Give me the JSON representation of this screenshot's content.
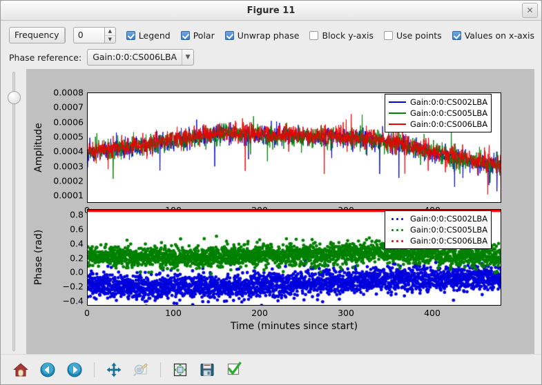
{
  "window": {
    "title": "Figure 11",
    "close_label": "✕"
  },
  "controls": {
    "axis_select": {
      "value": "Frequency",
      "arrow": "chevron-down-icon"
    },
    "index_spinner": {
      "value": "0",
      "up": "▲",
      "down": "▼"
    },
    "checkboxes": [
      {
        "label": "Legend",
        "checked": true
      },
      {
        "label": "Polar",
        "checked": true
      },
      {
        "label": "Unwrap phase",
        "checked": true
      },
      {
        "label": "Block y-axis",
        "checked": false
      },
      {
        "label": "Use points",
        "checked": false
      },
      {
        "label": "Values on x-axis",
        "checked": true
      }
    ],
    "phase_reference": {
      "label": "Phase reference:",
      "value": "Gain:0:0:CS006LBA",
      "arrow": "chevron-down-icon"
    }
  },
  "toolbar": {
    "buttons": [
      {
        "name": "home-button",
        "icon": "home-icon"
      },
      {
        "name": "back-button",
        "icon": "arrow-left-circle-icon"
      },
      {
        "name": "forward-button",
        "icon": "arrow-right-circle-icon"
      },
      {
        "name": "pan-button",
        "icon": "move-arrows-icon"
      },
      {
        "name": "zoom-button",
        "icon": "magnifier-rect-icon"
      },
      {
        "name": "configure-subplots-button",
        "icon": "subplots-icon"
      },
      {
        "name": "save-button",
        "icon": "floppy-disk-icon"
      },
      {
        "name": "apply-button",
        "icon": "green-check-icon"
      }
    ]
  },
  "colors": {
    "series_blue": "#0000dd",
    "series_green": "#008000",
    "series_red": "#ee0000",
    "canvas_bg": "#c0c0c0",
    "plot_bg": "#ffffff",
    "accent_checkbox": "#3d7ec4"
  },
  "chart_data": [
    {
      "type": "line",
      "title": "",
      "xlabel": "Time (minutes since start)",
      "ylabel": "Amplitude",
      "xlim": [
        0,
        480
      ],
      "ylim": [
        5e-05,
        0.0008
      ],
      "xticks": [
        0,
        100,
        200,
        300,
        400
      ],
      "yticks": [
        0.0001,
        0.0002,
        0.0003,
        0.0004,
        0.0005,
        0.0006,
        0.0007,
        0.0008
      ],
      "ytick_labels": [
        "0.0001",
        "0.0002",
        "0.0003",
        "0.0004",
        "0.0005",
        "0.0006",
        "0.0007",
        "0.0008"
      ],
      "xtick_labels": [
        "0",
        "100",
        "200",
        "300",
        "400"
      ],
      "grid": false,
      "legend_position": "upper right",
      "legend_style": "line",
      "series": [
        {
          "name": "Gain:0:0:CS002LBA",
          "color": "#0000dd",
          "mean_trend": [
            0.0004,
            0.00042,
            0.00044,
            0.00047,
            0.0005,
            0.00052,
            0.00052,
            0.00051,
            0.0005,
            0.0005,
            0.00049,
            0.00046,
            0.00042,
            0.00037,
            0.00033,
            0.00031
          ],
          "noise": 8e-05
        },
        {
          "name": "Gain:0:0:CS005LBA",
          "color": "#008000",
          "mean_trend": [
            0.0004,
            0.00042,
            0.00044,
            0.00047,
            0.0005,
            0.00052,
            0.00052,
            0.00051,
            0.0005,
            0.0005,
            0.00049,
            0.00046,
            0.00042,
            0.00037,
            0.00033,
            0.00031
          ],
          "noise": 8e-05
        },
        {
          "name": "Gain:0:0:CS006LBA",
          "color": "#ee0000",
          "mean_trend": [
            0.00041,
            0.00043,
            0.00045,
            0.00048,
            0.00051,
            0.00053,
            0.00053,
            0.00052,
            0.00051,
            0.00051,
            0.0005,
            0.00047,
            0.00043,
            0.00038,
            0.00034,
            0.00032
          ],
          "noise": 8e-05
        }
      ]
    },
    {
      "type": "scatter",
      "title": "",
      "xlabel": "Time (minutes since start)",
      "ylabel": "Phase (rad)",
      "xlim": [
        0,
        480
      ],
      "ylim": [
        -0.47,
        0.88
      ],
      "xticks": [
        0,
        100,
        200,
        300,
        400
      ],
      "yticks": [
        -0.4,
        -0.2,
        0.0,
        0.2,
        0.4,
        0.6,
        0.8
      ],
      "ytick_labels": [
        "−0.4",
        "−0.2",
        "0.0",
        "0.2",
        "0.4",
        "0.6",
        "0.8"
      ],
      "xtick_labels": [
        "0",
        "100",
        "200",
        "300",
        "400"
      ],
      "grid": false,
      "legend_position": "upper right",
      "legend_style": "dots",
      "series": [
        {
          "name": "Gain:0:0:CS002LBA",
          "color": "#0000dd",
          "mean_trend": [
            -0.17,
            -0.19,
            -0.21,
            -0.2,
            -0.19,
            -0.2,
            -0.18,
            -0.16,
            -0.14,
            -0.13,
            -0.12,
            -0.1,
            -0.09,
            -0.08,
            -0.07,
            -0.08
          ],
          "noise": 0.085
        },
        {
          "name": "Gain:0:0:CS005LBA",
          "color": "#008000",
          "mean_trend": [
            0.22,
            0.22,
            0.22,
            0.21,
            0.22,
            0.23,
            0.24,
            0.24,
            0.25,
            0.26,
            0.27,
            0.28,
            0.27,
            0.26,
            0.24,
            0.22
          ],
          "noise": 0.075
        },
        {
          "name": "Gain:0:0:CS006LBA",
          "color": "#ee0000",
          "constant": 0.865,
          "noise": 0.0
        }
      ]
    }
  ]
}
